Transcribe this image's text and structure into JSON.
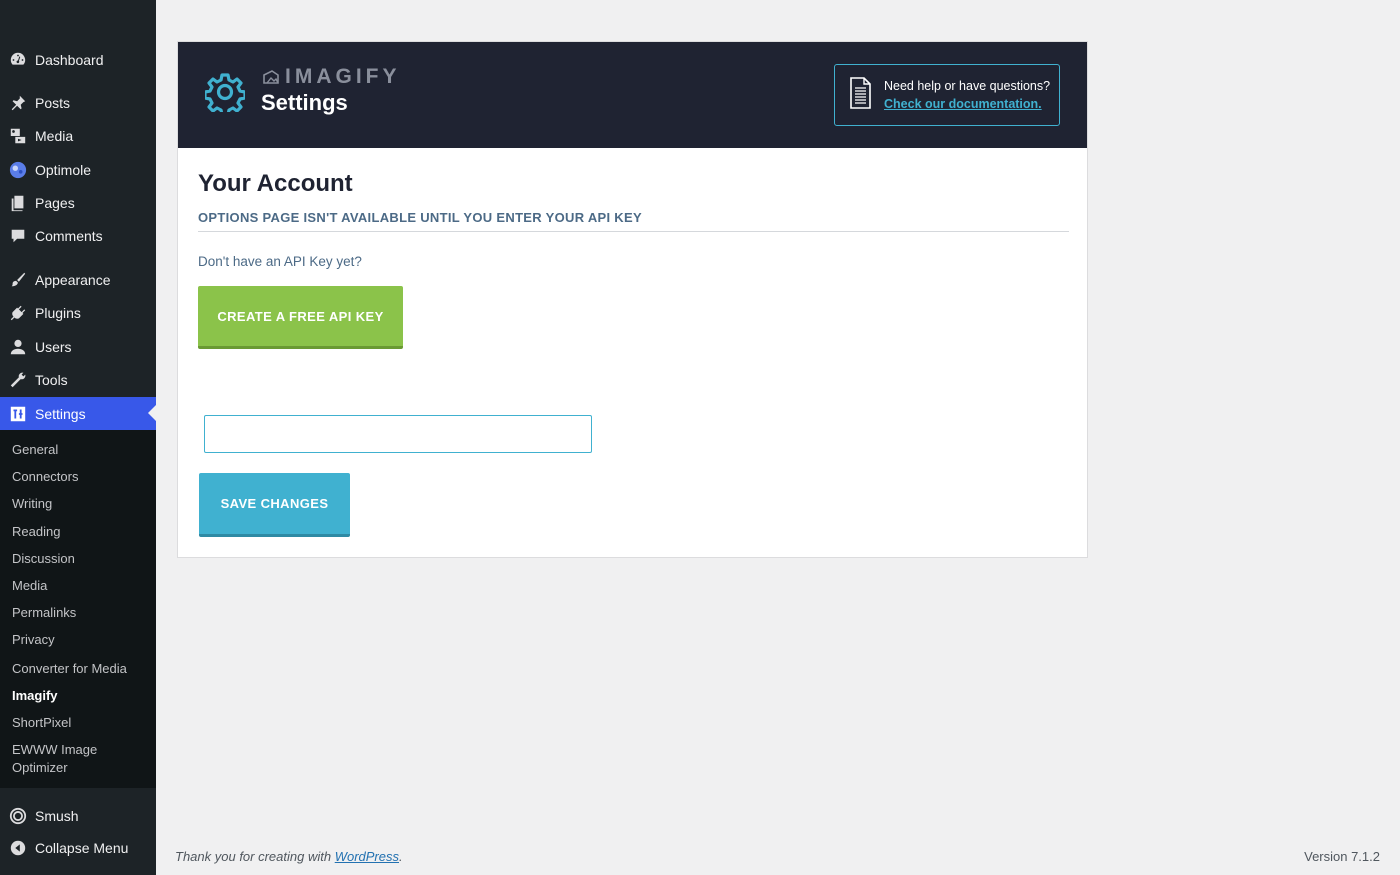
{
  "sidebar": {
    "items": [
      {
        "label": "Dashboard",
        "icon": "dashboard-icon"
      },
      {
        "label": "Posts",
        "icon": "pin-icon"
      },
      {
        "label": "Media",
        "icon": "media-icon"
      },
      {
        "label": "Optimole",
        "icon": "optimole-icon"
      },
      {
        "label": "Pages",
        "icon": "pages-icon"
      },
      {
        "label": "Comments",
        "icon": "comment-icon"
      },
      {
        "label": "Appearance",
        "icon": "brush-icon"
      },
      {
        "label": "Plugins",
        "icon": "plugin-icon"
      },
      {
        "label": "Users",
        "icon": "user-icon"
      },
      {
        "label": "Tools",
        "icon": "wrench-icon"
      },
      {
        "label": "Settings",
        "icon": "settings-icon"
      }
    ],
    "submenu": [
      "General",
      "Connectors",
      "Writing",
      "Reading",
      "Discussion",
      "Media",
      "Permalinks",
      "Privacy",
      "Converter for Media",
      "Imagify",
      "ShortPixel",
      "EWWW Image Optimizer"
    ],
    "bottom": [
      {
        "label": "Smush",
        "icon": "smush-icon"
      },
      {
        "label": "Collapse Menu",
        "icon": "collapse-icon"
      }
    ]
  },
  "header": {
    "brand": "IMAGIFY",
    "title": "Settings",
    "help_question": "Need help or have questions?",
    "help_link": "Check our documentation."
  },
  "account": {
    "title": "Your Account",
    "subtitle": "OPTIONS PAGE ISN'T AVAILABLE UNTIL YOU ENTER YOUR API KEY",
    "no_key_text": "Don't have an API Key yet?",
    "create_button": "CREATE A FREE API KEY",
    "api_key_value": "",
    "save_button": "SAVE CHANGES"
  },
  "footer": {
    "thanks_prefix": "Thank you for creating with ",
    "wordpress_link": "WordPress",
    "thanks_suffix": ".",
    "version": "Version 7.1.2"
  },
  "colors": {
    "sidebar_bg": "#1d2327",
    "active_menu": "#3858e9",
    "header_bg": "#1f2332",
    "accent_blue": "#40b1d0",
    "create_green": "#8bc34a"
  }
}
